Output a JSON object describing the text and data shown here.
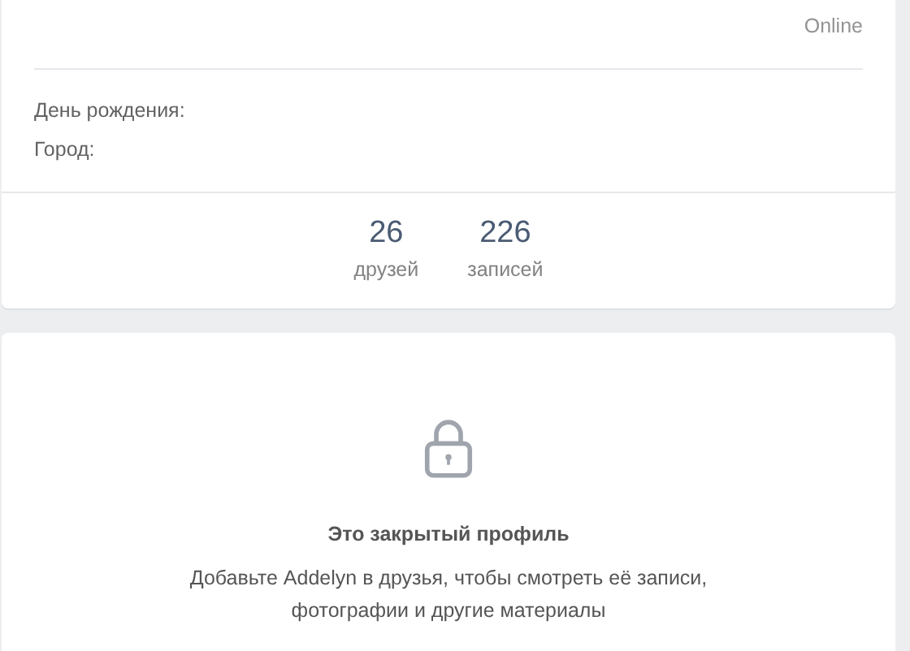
{
  "profile": {
    "status": "Online",
    "info": [
      {
        "label": "День рождения:"
      },
      {
        "label": "Город:"
      }
    ],
    "counters": [
      {
        "value": "26",
        "label": "друзей"
      },
      {
        "value": "226",
        "label": "записей"
      }
    ]
  },
  "closed": {
    "title": "Это закрытый профиль",
    "text": "Добавьте Addelyn в друзья, чтобы смотреть её записи, фотографии и другие материалы"
  }
}
